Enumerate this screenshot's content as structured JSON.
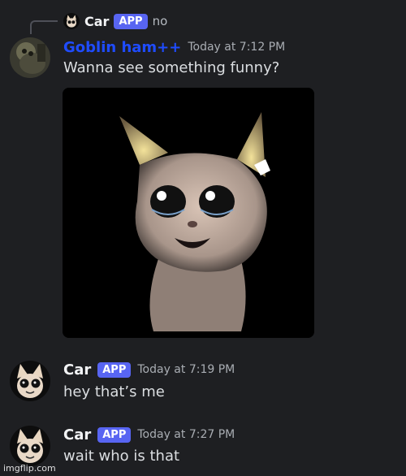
{
  "reply": {
    "username": "Car",
    "badge": "APP",
    "snippet": "no"
  },
  "messages": [
    {
      "username": "Goblin ham++",
      "timestamp": "Today at 7:12 PM",
      "text": "Wanna see something funny?",
      "name_color": "#1f4cff"
    },
    {
      "username": "Car",
      "badge": "APP",
      "timestamp": "Today at 7:19 PM",
      "text": "hey that’s me"
    },
    {
      "username": "Car",
      "badge": "APP",
      "timestamp": "Today at 7:27 PM",
      "text": "wait who is that"
    }
  ],
  "attachment": {
    "icon": "cat-image"
  },
  "watermark": "imgflip.com",
  "colors": {
    "background": "#1e1f22",
    "badge": "#5865f2",
    "text": "#dbdee1",
    "muted": "#a9adb3"
  }
}
